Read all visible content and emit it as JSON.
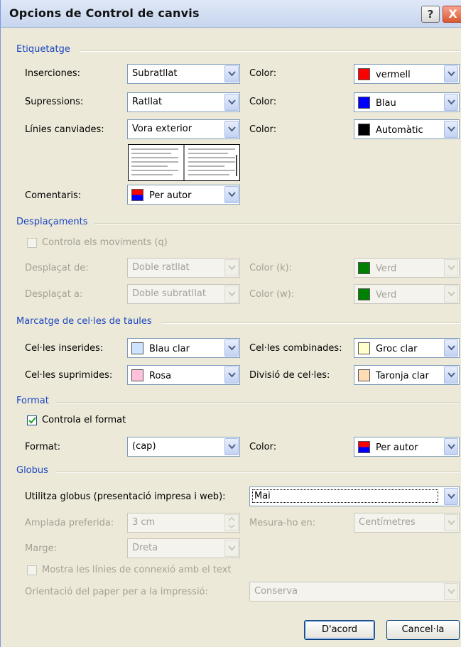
{
  "dialog": {
    "title": "Opcions de Control de canvis",
    "help_label": "?",
    "close_label": "X"
  },
  "sections": {
    "etiquetatge": "Etiquetatge",
    "desplacaments": "Desplaçaments",
    "marcatge": "Marcatge de cel·les de taules",
    "format": "Format",
    "globus": "Globus"
  },
  "etiquetatge": {
    "insercions": {
      "label": "Inserciones:",
      "value": "Subratllat",
      "color_label": "Color:",
      "color_value": "vermell",
      "color_hex": "#ff0000"
    },
    "supressions": {
      "label": "Supressions:",
      "value": "Ratllat",
      "color_label": "Color:",
      "color_value": "Blau",
      "color_hex": "#0000ff"
    },
    "linies": {
      "label": "Línies canviades:",
      "value": "Vora exterior",
      "color_label": "Color:",
      "color_value": "Automàtic",
      "color_hex": "#000000"
    },
    "comentaris": {
      "label": "Comentaris:",
      "value": "Per autor"
    }
  },
  "desplacaments": {
    "checkbox_label": "Controla els moviments (q)",
    "checked": false,
    "desplacat_de": {
      "label": "Desplaçat de:",
      "value": "Doble ratllat",
      "color_label": "Color (k):",
      "color_value": "Verd",
      "color_hex": "#008000"
    },
    "desplacat_a": {
      "label": "Desplaçat a:",
      "value": "Doble subratllat",
      "color_label": "Color (w):",
      "color_value": "Verd",
      "color_hex": "#008000"
    }
  },
  "marcatge": {
    "inserides": {
      "label": "Cel·les inserides:",
      "value": "Blau clar",
      "color_hex": "#cce4ff"
    },
    "combinades": {
      "label": "Cel·les combinades:",
      "value": "Groc clar",
      "color_hex": "#ffffcc"
    },
    "suprimides": {
      "label": "Cel·les suprimides:",
      "value": "Rosa",
      "color_hex": "#ffc0dc"
    },
    "divisio": {
      "label": "Divisió de cel·les:",
      "value": "Taronja clar",
      "color_hex": "#ffdcb4"
    }
  },
  "format": {
    "checkbox_label": "Controla el format",
    "checked": true,
    "format_label": "Format:",
    "format_value": "(cap)",
    "color_label": "Color:",
    "color_value": "Per autor"
  },
  "globus": {
    "utilitza_label": "Utilitza globus (presentació impresa i web):",
    "utilitza_value": "Mai",
    "amplada_label": "Amplada preferida:",
    "amplada_value": "3 cm",
    "mesura_label": "Mesura-ho en:",
    "mesura_value": "Centímetres",
    "marge_label": "Marge:",
    "marge_value": "Dreta",
    "mostra_label": "Mostra les línies de connexió amb el text",
    "orientacio_label": "Orientació del paper per a la impressió:",
    "orientacio_value": "Conserva"
  },
  "buttons": {
    "ok": "D'acord",
    "cancel": "Cancel·la"
  }
}
